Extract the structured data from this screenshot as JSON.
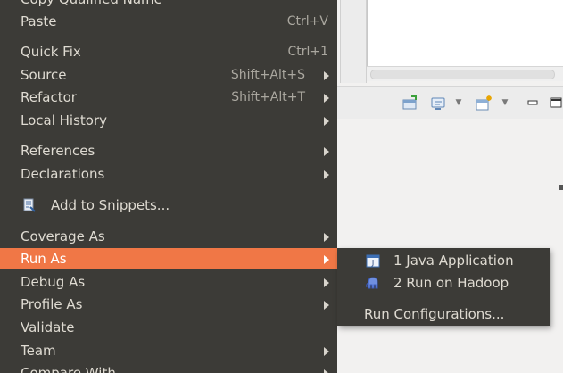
{
  "menu": {
    "items": [
      {
        "label": "Copy Qualified Name"
      },
      {
        "label": "Paste",
        "accel": "Ctrl+V"
      },
      {
        "label": "Quick Fix",
        "accel": "Ctrl+1"
      },
      {
        "label": "Source",
        "accel": "Shift+Alt+S"
      },
      {
        "label": "Refactor",
        "accel": "Shift+Alt+T"
      },
      {
        "label": "Local History"
      },
      {
        "label": "References"
      },
      {
        "label": "Declarations"
      },
      {
        "label": "Add to Snippets..."
      },
      {
        "label": "Coverage As"
      },
      {
        "label": "Run As"
      },
      {
        "label": "Debug As"
      },
      {
        "label": "Profile As"
      },
      {
        "label": "Validate"
      },
      {
        "label": "Team"
      },
      {
        "label": "Compare With"
      }
    ]
  },
  "submenu": {
    "items": [
      {
        "label": "1 Java Application"
      },
      {
        "label": "2 Run on Hadoop"
      },
      {
        "label": "Run Configurations..."
      }
    ]
  },
  "colors": {
    "menu_bg": "#3c3b37",
    "highlight": "#f07746",
    "text": "#dfdbd2"
  }
}
